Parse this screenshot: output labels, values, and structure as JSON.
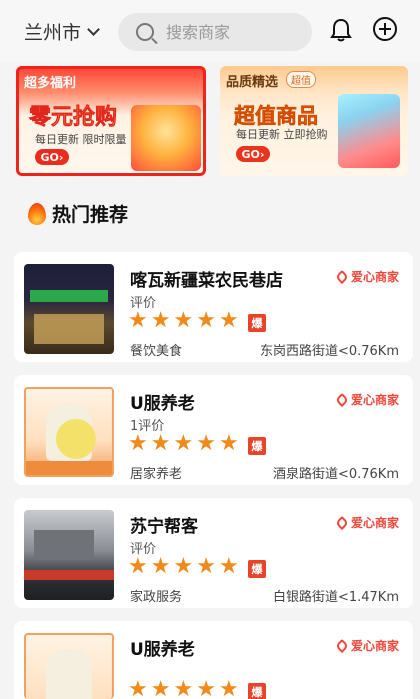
{
  "header": {
    "city": "兰州市",
    "search_placeholder": "搜索商家"
  },
  "promos": [
    {
      "title": "超多福利",
      "headline": "零元抢购",
      "subtitle": "每日更新 限时限量",
      "go": "GO›"
    },
    {
      "title": "品质精选",
      "tag": "超值",
      "headline": "超值商品",
      "subtitle": "每日更新 立即抢购",
      "go": "GO›"
    }
  ],
  "section": {
    "title": "热门推荐"
  },
  "badge_text": "爱心商家",
  "hot_badge": "爆",
  "stores": [
    {
      "name": "喀瓦新疆菜农民巷店",
      "reviews": "评价",
      "category": "餐饮美食",
      "address": "东岗西路街道<0.76Km",
      "rating": 5
    },
    {
      "name": "U服养老",
      "reviews": "1评价",
      "category": "居家养老",
      "address": "酒泉路街道<0.76Km",
      "rating": 5
    },
    {
      "name": "苏宁帮客",
      "reviews": "评价",
      "category": "家政服务",
      "address": "白银路街道<1.47Km",
      "rating": 5
    },
    {
      "name": "U服养老",
      "reviews": "",
      "category": "",
      "address": "",
      "rating": 5
    }
  ],
  "colors": {
    "accent": "#f0231b",
    "star": "#f08a1a",
    "love": "#f0473a"
  }
}
